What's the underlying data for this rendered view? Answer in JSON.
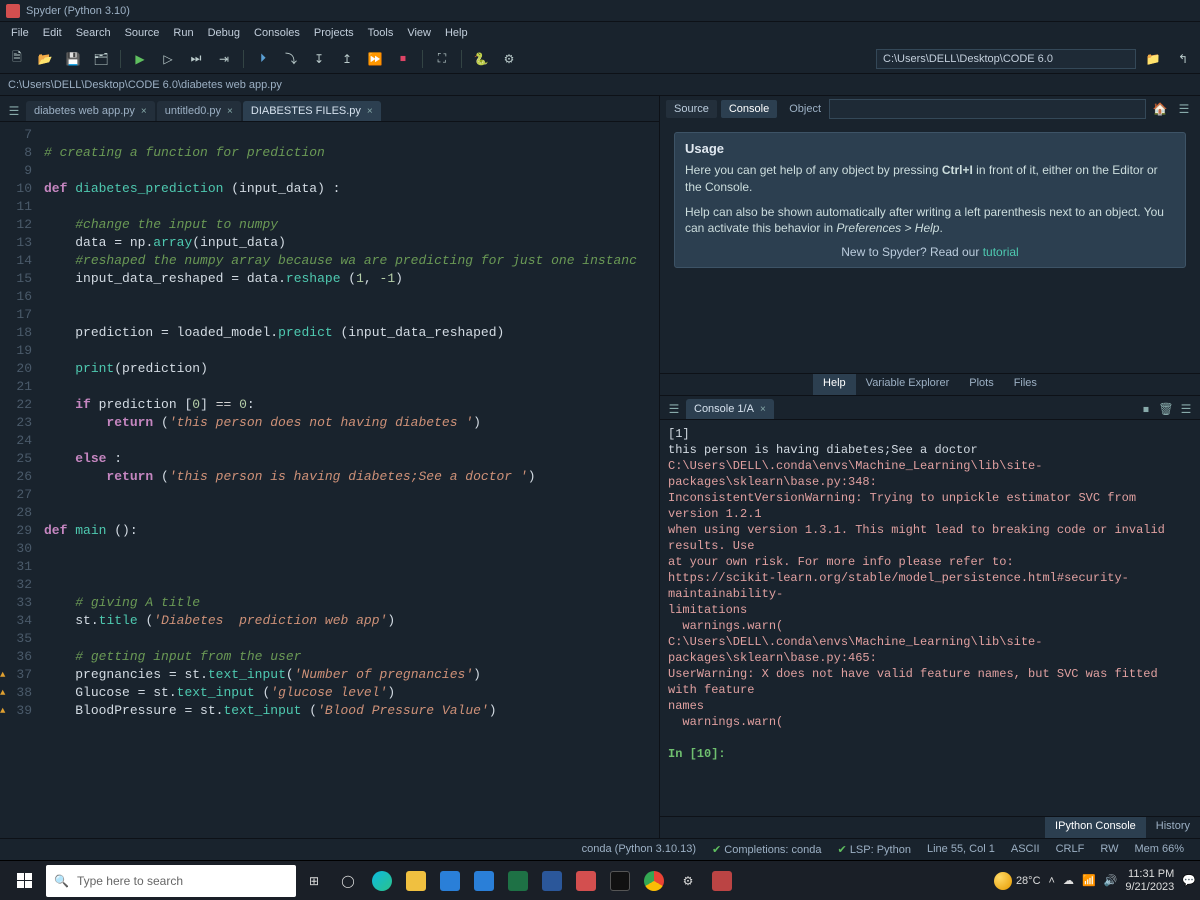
{
  "app": {
    "title": "Spyder (Python 3.10)"
  },
  "menu": {
    "items": [
      "File",
      "Edit",
      "Search",
      "Source",
      "Run",
      "Debug",
      "Consoles",
      "Projects",
      "Tools",
      "View",
      "Help"
    ]
  },
  "toolbar": {
    "cwd": "C:\\Users\\DELL\\Desktop\\CODE 6.0"
  },
  "pathbar": {
    "path": "C:\\Users\\DELL\\Desktop\\CODE 6.0\\diabetes web app.py"
  },
  "editor": {
    "tabs": [
      {
        "label": "diabetes web app.py",
        "active": false
      },
      {
        "label": "untitled0.py",
        "active": false
      },
      {
        "label": "DIABESTES FILES.py",
        "active": true
      }
    ],
    "first_line": 7,
    "lines": [
      {
        "n": 7,
        "html": ""
      },
      {
        "n": 8,
        "html": "<span class='c'># creating a function for prediction</span>"
      },
      {
        "n": 9,
        "html": ""
      },
      {
        "n": 10,
        "html": "<span class='k'>def</span> <span class='fn'>diabetes_prediction</span> (<span class='id'>input_data</span>) :"
      },
      {
        "n": 11,
        "html": ""
      },
      {
        "n": 12,
        "html": "    <span class='c'>#change the input to numpy</span>"
      },
      {
        "n": 13,
        "html": "    <span class='id'>data</span> = <span class='id'>np</span>.<span class='fn'>array</span>(<span class='id'>input_data</span>)"
      },
      {
        "n": 14,
        "html": "    <span class='c'>#reshaped the numpy array because wa are predicting for just one instanc</span>"
      },
      {
        "n": 15,
        "html": "    <span class='id'>input_data_reshaped</span> = <span class='id'>data</span>.<span class='fn'>reshape</span> (<span class='n'>1</span>, <span class='n'>-1</span>)"
      },
      {
        "n": 16,
        "html": ""
      },
      {
        "n": 17,
        "html": ""
      },
      {
        "n": 18,
        "html": "    <span class='id'>prediction</span> = <span class='id'>loaded_model</span>.<span class='fn'>predict</span> (<span class='id'>input_data_reshaped</span>)"
      },
      {
        "n": 19,
        "html": ""
      },
      {
        "n": 20,
        "html": "    <span class='fn'>print</span>(<span class='id'>prediction</span>)"
      },
      {
        "n": 21,
        "html": ""
      },
      {
        "n": 22,
        "html": "    <span class='k'>if</span> <span class='id'>prediction</span> [<span class='n'>0</span>] <span class='op'>==</span> <span class='n'>0</span>:"
      },
      {
        "n": 23,
        "html": "        <span class='k'>return</span> (<span class='s'>'this person does not having diabetes '</span>)"
      },
      {
        "n": 24,
        "html": ""
      },
      {
        "n": 25,
        "html": "    <span class='k'>else</span> :"
      },
      {
        "n": 26,
        "html": "        <span class='k'>return</span> (<span class='s'>'this person is having diabetes;See a doctor '</span>)"
      },
      {
        "n": 27,
        "html": ""
      },
      {
        "n": 28,
        "html": ""
      },
      {
        "n": 29,
        "html": "<span class='k'>def</span> <span class='fn'>main</span> ():"
      },
      {
        "n": 30,
        "html": ""
      },
      {
        "n": 31,
        "html": ""
      },
      {
        "n": 32,
        "html": ""
      },
      {
        "n": 33,
        "html": "    <span class='c'># giving A title</span>"
      },
      {
        "n": 34,
        "html": "    <span class='id'>st</span>.<span class='fn'>title</span> (<span class='s'>'Diabetes  prediction web app'</span>)"
      },
      {
        "n": 35,
        "html": ""
      },
      {
        "n": 36,
        "html": "    <span class='c'># getting input from the user</span>"
      },
      {
        "n": 37,
        "warn": true,
        "html": "    <span class='id'>pregnancies</span> = <span class='id'>st</span>.<span class='fn'>text_input</span>(<span class='s'>'Number of pregnancies'</span>)"
      },
      {
        "n": 38,
        "warn": true,
        "html": "    <span class='id'>Glucose</span> = <span class='id'>st</span>.<span class='fn'>text_input</span> (<span class='s'>'glucose level'</span>)"
      },
      {
        "n": 39,
        "warn": true,
        "html": "    <span class='id'>BloodPressure</span> = <span class='id'>st</span>.<span class='fn'>text_input</span> (<span class='s'>'Blood Pressure Value'</span>)"
      }
    ]
  },
  "help": {
    "source_tabs": {
      "source": "Source",
      "console": "Console",
      "object": "Object"
    },
    "usage_title": "Usage",
    "p1_a": "Here you can get help of any object by pressing ",
    "p1_b": "Ctrl+I",
    "p1_c": " in front of it, either on the Editor or the Console.",
    "p2_a": "Help can also be shown automatically after writing a left parenthesis next to an object. You can activate this behavior in ",
    "p2_b": "Preferences > Help",
    "p2_c": ".",
    "foot_a": "New to Spyder? Read our ",
    "foot_b": "tutorial",
    "bottom_tabs": [
      "Help",
      "Variable Explorer",
      "Plots",
      "Files"
    ]
  },
  "console": {
    "tab_label": "Console 1/A",
    "lines": [
      "[1]",
      "this person is having diabetes;See a doctor",
      "C:\\Users\\DELL\\.conda\\envs\\Machine_Learning\\lib\\site-packages\\sklearn\\base.py:348:",
      "InconsistentVersionWarning: Trying to unpickle estimator SVC from version 1.2.1",
      "when using version 1.3.1. This might lead to breaking code or invalid results. Use",
      "at your own risk. For more info please refer to:",
      "https://scikit-learn.org/stable/model_persistence.html#security-maintainability-",
      "limitations",
      "  warnings.warn(",
      "C:\\Users\\DELL\\.conda\\envs\\Machine_Learning\\lib\\site-packages\\sklearn\\base.py:465:",
      "UserWarning: X does not have valid feature names, but SVC was fitted with feature",
      "names",
      "  warnings.warn("
    ],
    "prompt": "In [10]:",
    "bottom_tabs": [
      "IPython Console",
      "History"
    ]
  },
  "status": {
    "env": "conda (Python 3.10.13)",
    "completions": "Completions: conda",
    "lsp": "LSP: Python",
    "pos": "Line 55, Col 1",
    "enc": "ASCII",
    "eol": "CRLF",
    "rw": "RW",
    "mem": "Mem 66%"
  },
  "taskbar": {
    "search_placeholder": "Type here to search",
    "weather": "28°C",
    "time": "11:31 PM",
    "date": "9/21/2023"
  }
}
